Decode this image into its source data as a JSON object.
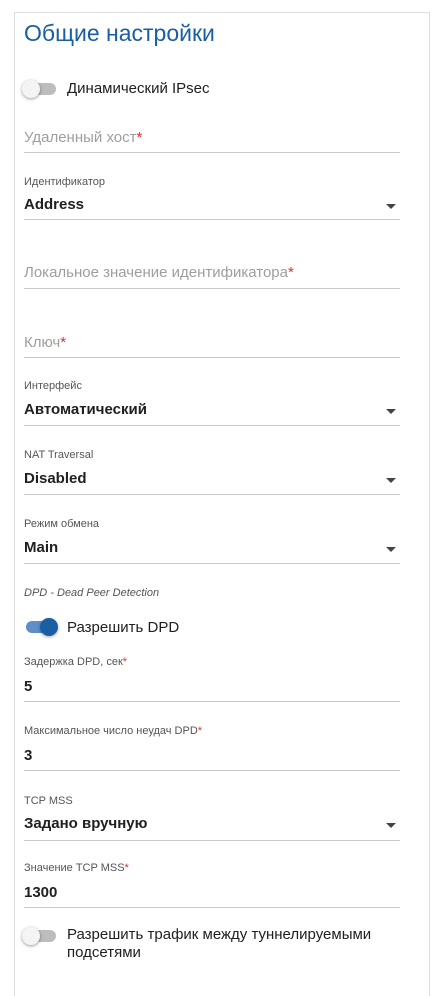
{
  "title": "Общие настройки",
  "dynamic_ipsec": {
    "label": "Динамический IPsec",
    "enabled": false
  },
  "remote_host": {
    "placeholder": "Удаленный хост",
    "required_mark": "*",
    "value": ""
  },
  "identifier": {
    "label": "Идентификатор",
    "value": "Address"
  },
  "local_id": {
    "placeholder": "Локальное значение идентификатора",
    "required_mark": "*",
    "value": ""
  },
  "key": {
    "placeholder": "Ключ",
    "required_mark": "*",
    "value": ""
  },
  "interface": {
    "label": "Интерфейс",
    "value": "Автоматический"
  },
  "nat_traversal": {
    "label": "NAT Traversal",
    "value": "Disabled"
  },
  "exchange_mode": {
    "label": "Режим обмена",
    "value": "Main"
  },
  "dpd_section": "DPD - Dead Peer Detection",
  "enable_dpd": {
    "label": "Разрешить DPD",
    "enabled": true
  },
  "dpd_delay": {
    "label": "Задержка DPD, сек",
    "required_mark": "*",
    "value": "5"
  },
  "dpd_failures": {
    "label": "Максимальное число неудач DPD",
    "required_mark": "*",
    "value": "3"
  },
  "tcp_mss": {
    "label": "TCP MSS",
    "value": "Задано вручную"
  },
  "tcp_mss_value": {
    "label": "Значение TCP MSS",
    "required_mark": "*",
    "value": "1300"
  },
  "allow_tunnel_traffic": {
    "label_line1": "Разрешить трафик между туннелируемыми",
    "label_line2": "подсетями",
    "enabled": false
  },
  "colors": {
    "accent": "#1a5fa3",
    "required": "#e03030"
  }
}
